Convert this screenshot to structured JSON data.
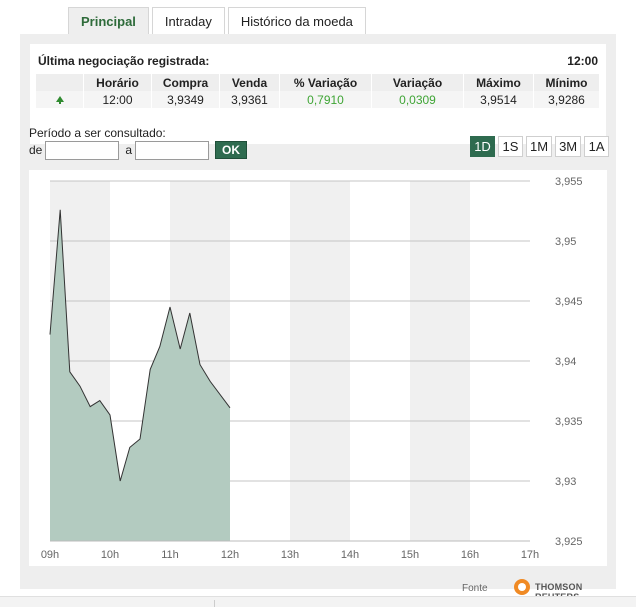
{
  "tabs": [
    {
      "label": "Principal",
      "active": true
    },
    {
      "label": "Intraday",
      "active": false
    },
    {
      "label": "Histórico da moeda",
      "active": false
    }
  ],
  "quote": {
    "title": "Última negociação registrada:",
    "time": "12:00",
    "headers": [
      "Horário",
      "Compra",
      "Venda",
      "% Variação",
      "Variação",
      "Máximo",
      "Mínimo"
    ],
    "trend_icon": "up-arrow-icon",
    "row": {
      "horario": "12:00",
      "compra": "3,9349",
      "venda": "3,9361",
      "pct_variacao": "0,7910",
      "variacao": "0,0309",
      "maximo": "3,9514",
      "minimo": "3,9286"
    },
    "positive_color": "#3fa535"
  },
  "period": {
    "label": "Período a ser consultado:",
    "de_label": "de",
    "a_label": "a",
    "de_value": "",
    "a_value": "",
    "ok_label": "OK"
  },
  "ranges": [
    {
      "label": "1D",
      "active": true
    },
    {
      "label": "1S",
      "active": false
    },
    {
      "label": "1M",
      "active": false
    },
    {
      "label": "3M",
      "active": false
    },
    {
      "label": "1A",
      "active": false
    }
  ],
  "chart_data": {
    "type": "area",
    "x_tick_labels": [
      "09h",
      "10h",
      "11h",
      "12h",
      "13h",
      "14h",
      "15h",
      "16h",
      "17h"
    ],
    "y_tick_labels": [
      "3,955",
      "3,95",
      "3,945",
      "3,94",
      "3,935",
      "3,93",
      "3,925"
    ],
    "ylim": [
      3.925,
      3.955
    ],
    "xlim": [
      9,
      17
    ],
    "grid": true,
    "fill_color": "#b3cbc0",
    "line_color": "#333333",
    "x": [
      9.0,
      9.17,
      9.33,
      9.5,
      9.67,
      9.83,
      10.0,
      10.17,
      10.33,
      10.5,
      10.67,
      10.83,
      11.0,
      11.17,
      11.33,
      11.5,
      11.67,
      12.0
    ],
    "values": [
      3.9422,
      3.9526,
      3.9391,
      3.9379,
      3.9362,
      3.9367,
      3.9355,
      3.93,
      3.9328,
      3.9335,
      3.9393,
      3.9412,
      3.9445,
      3.941,
      3.944,
      3.9397,
      3.9383,
      3.9361
    ]
  },
  "source": {
    "fonte_label": "Fonte",
    "provider": "THOMSON REUTERS"
  }
}
